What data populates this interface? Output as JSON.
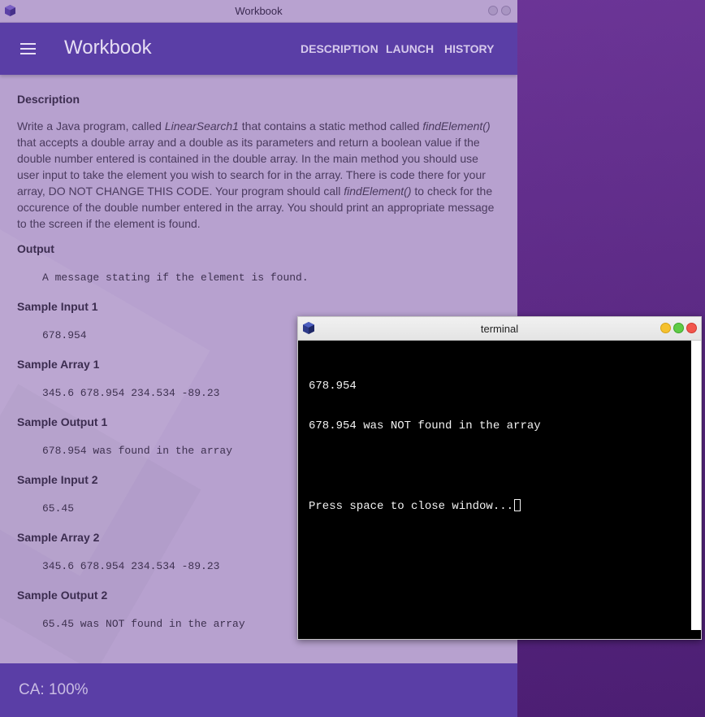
{
  "workbook_window": {
    "title": "Workbook",
    "app_title": "Workbook",
    "nav": {
      "description": "DESCRIPTION",
      "launch": "LAUNCH",
      "history": "HISTORY"
    },
    "description": {
      "heading": "Description",
      "text_1": "Write a Java program, called ",
      "class_name": "LinearSearch1",
      "text_2": " that contains a static method called ",
      "method_name_1": "findElement()",
      "text_3": " that accepts a double array and a double as its parameters and return a boolean value if the double number entered is contained in the double array. In the main method you should use user input to take the element you wish to search for in the array. There is code there for your array, DO NOT CHANGE THIS CODE. Your program should call ",
      "method_name_2": "findElement()",
      "text_4": " to check for the occurence of the double number entered in the array. You should print an appropriate message to the screen if the element is found."
    },
    "sections": [
      {
        "heading": "Output",
        "value": "A message stating if the element is found."
      },
      {
        "heading": "Sample Input 1",
        "value": "678.954"
      },
      {
        "heading": "Sample Array 1",
        "value": "345.6 678.954 234.534 -89.23"
      },
      {
        "heading": "Sample Output 1",
        "value": "678.954 was found in the array"
      },
      {
        "heading": "Sample Input 2",
        "value": "65.45"
      },
      {
        "heading": "Sample Array 2",
        "value": "345.6 678.954 234.534 -89.23"
      },
      {
        "heading": "Sample Output 2",
        "value": "65.45 was NOT found in the array"
      }
    ],
    "footer": {
      "score": "CA: 100%"
    }
  },
  "terminal_window": {
    "title": "terminal",
    "lines": [
      "678.954",
      "678.954 was NOT found in the array",
      "",
      "Press space to close window..."
    ]
  },
  "colors": {
    "appbar": "#5a3ea6",
    "workbook_bg": "#b7a1cf",
    "desktop": "#5a2585",
    "terminal_bg": "#000000"
  }
}
